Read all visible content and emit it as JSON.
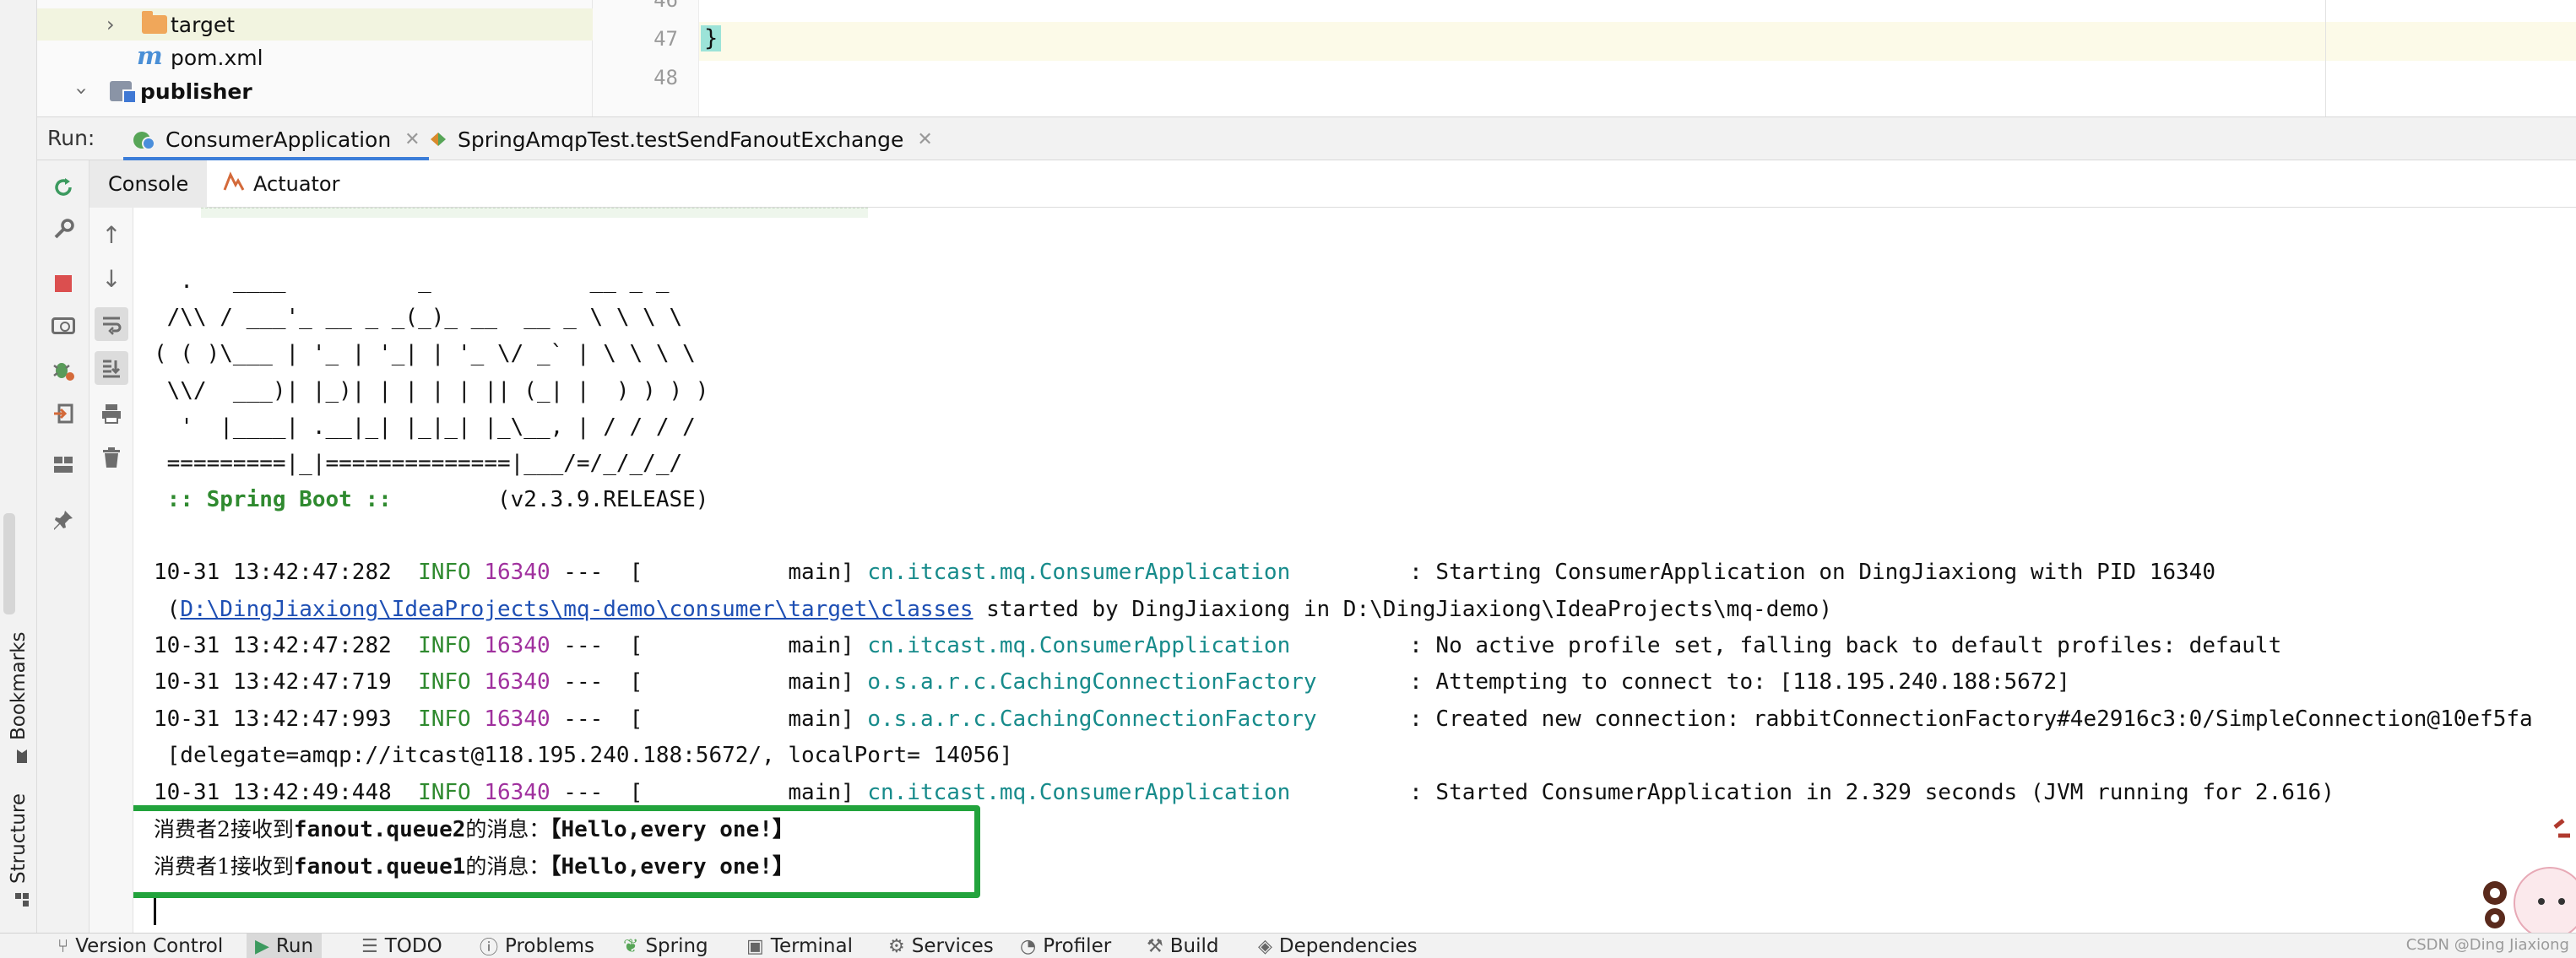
{
  "tree": {
    "items": [
      {
        "label": "target",
        "type": "folder"
      },
      {
        "label": "pom.xml",
        "type": "maven"
      },
      {
        "label": "publisher",
        "type": "module"
      }
    ]
  },
  "editor": {
    "lines": [
      "46",
      "47",
      "48"
    ],
    "code": "}"
  },
  "run": {
    "label": "Run:",
    "tabs": [
      "ConsumerApplication",
      "SpringAmqpTest.testSendFanoutExchange"
    ]
  },
  "subtabs": [
    "Console",
    "Actuator"
  ],
  "console": {
    "banner": [
      "  .   ____          _            __ _ _",
      " /\\\\ / ___'_ __ _ _(_)_ __  __ _ \\ \\ \\ \\",
      "( ( )\\___ | '_ | '_| | '_ \\/ _` | \\ \\ \\ \\",
      " \\\\/  ___)| |_)| | | | | || (_| |  ) ) ) )",
      "  '  |____| .__|_| |_|_| |_\\__, | / / / /",
      " =========|_|==============|___/=/_/_/_/"
    ],
    "boot_label": " :: Spring Boot :: ",
    "boot_version": "       (v2.3.9.RELEASE)",
    "logs": [
      {
        "ts": "10-31 13:42:47:282",
        "level": "INFO",
        "pid": "16340",
        "thread": "---  [           main]",
        "logger": "cn.itcast.mq.ConsumerApplication",
        "msg": "         : Starting ConsumerApplication on DingJiaxiong with PID 16340"
      },
      {
        "ts": "10-31 13:42:47:282",
        "level": "INFO",
        "pid": "16340",
        "thread": "---  [           main]",
        "logger": "cn.itcast.mq.ConsumerApplication",
        "msg": "         : No active profile set, falling back to default profiles: default"
      },
      {
        "ts": "10-31 13:42:47:719",
        "level": "INFO",
        "pid": "16340",
        "thread": "---  [           main]",
        "logger": "o.s.a.r.c.CachingConnectionFactory",
        "msg": "       : Attempting to connect to: [118.195.240.188:5672]"
      },
      {
        "ts": "10-31 13:42:47:993",
        "level": "INFO",
        "pid": "16340",
        "thread": "---  [           main]",
        "logger": "o.s.a.r.c.CachingConnectionFactory",
        "msg": "       : Created new connection: rabbitConnectionFactory#4e2916c3:0/SimpleConnection@10ef5fa"
      },
      {
        "ts": "10-31 13:42:49:448",
        "level": "INFO",
        "pid": "16340",
        "thread": "---  [           main]",
        "logger": "cn.itcast.mq.ConsumerApplication",
        "msg": "         : Started ConsumerApplication in 2.329 seconds (JVM running for 2.616)"
      }
    ],
    "path_prefix": " (",
    "path_link": "D:\\DingJiaxiong\\IdeaProjects\\mq-demo\\consumer\\target\\classes",
    "path_suffix": " started by DingJiaxiong in D:\\DingJiaxiong\\IdeaProjects\\mq-demo)",
    "delegate_line": " [delegate=amqp://itcast@118.195.240.188:5672/, localPort= 14056]",
    "messages": [
      {
        "prefix": "消费者2接收到",
        "queue": "fanout.queue2",
        "mid": "的消息：",
        "body": "【Hello,every one!】"
      },
      {
        "prefix": "消费者1接收到",
        "queue": "fanout.queue1",
        "mid": "的消息：",
        "body": "【Hello,every one!】"
      }
    ]
  },
  "left_stripe": {
    "bookmarks": "Bookmarks",
    "structure": "Structure"
  },
  "bottom": {
    "items": [
      "Version Control",
      "Run",
      "TODO",
      "Problems",
      "Spring",
      "Terminal",
      "Services",
      "Profiler",
      "Build",
      "Dependencies"
    ],
    "watermark": "CSDN @Ding Jiaxiong"
  }
}
